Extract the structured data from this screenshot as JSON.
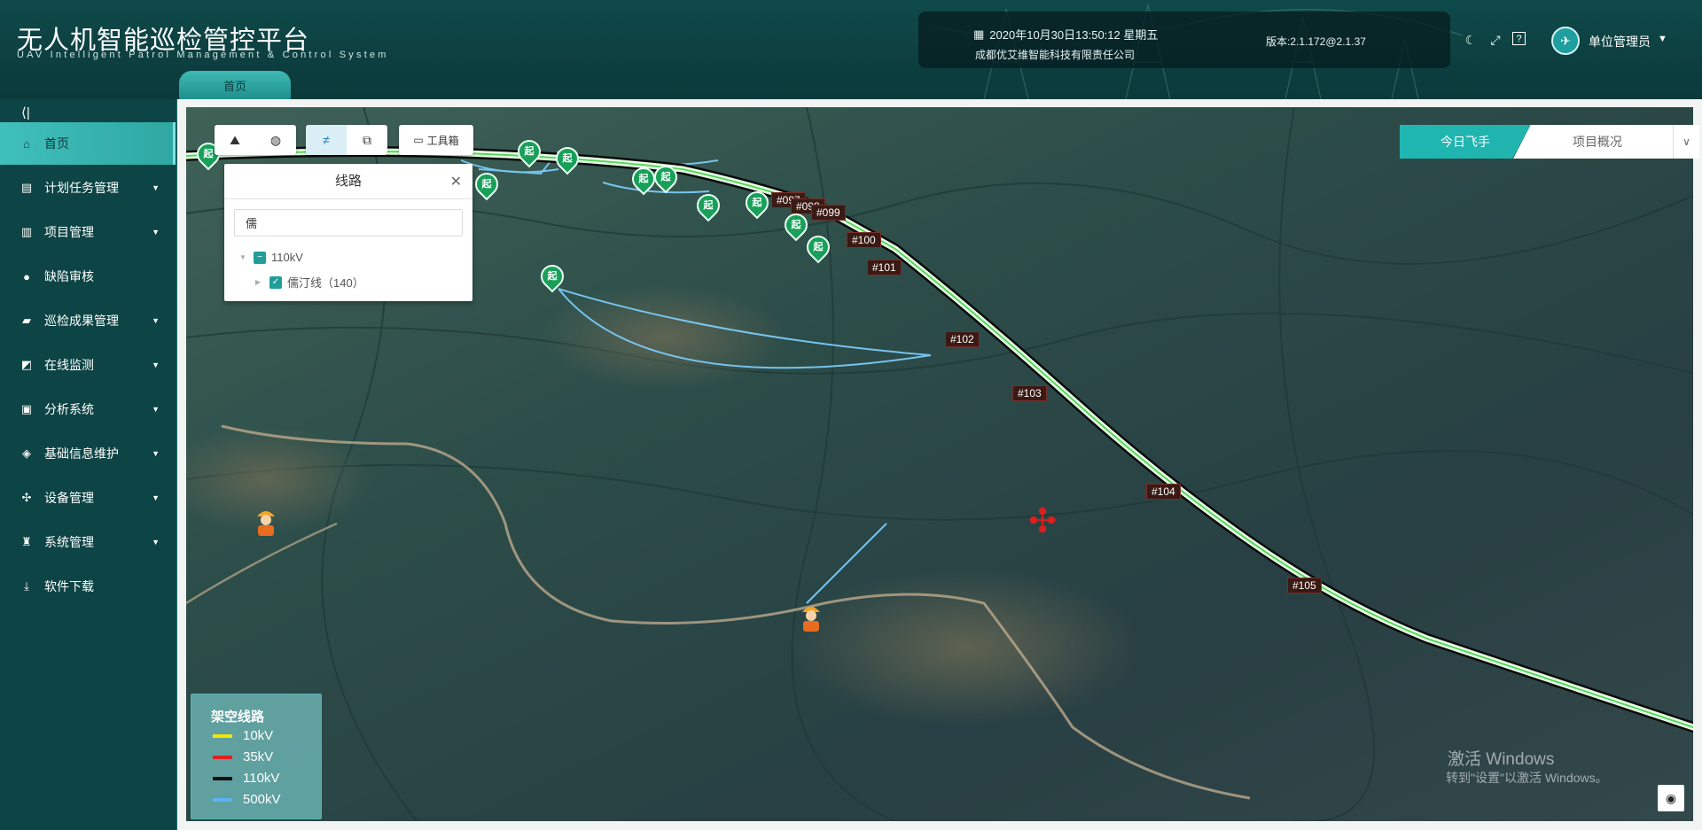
{
  "header": {
    "title": "无人机智能巡检管控平台",
    "subtitle": "UAV Intelligent Patrol Management & Control System",
    "datetime": "2020年10月30日13:50:12 星期五",
    "company": "成都优艾维智能科技有限责任公司",
    "version": "版本:2.1.172@2.1.37",
    "user": "单位管理员",
    "icons": [
      "theme-icon",
      "fullscreen-icon",
      "help-icon"
    ]
  },
  "tabs": [
    {
      "label": "首页"
    }
  ],
  "sidebar": {
    "items": [
      {
        "label": "首页",
        "icon": "home-icon",
        "active": true
      },
      {
        "label": "计划任务管理",
        "icon": "calendar-icon",
        "expandable": true
      },
      {
        "label": "项目管理",
        "icon": "project-icon",
        "expandable": true
      },
      {
        "label": "缺陷审核",
        "icon": "user-icon"
      },
      {
        "label": "巡检成果管理",
        "icon": "folder-icon",
        "expandable": true
      },
      {
        "label": "在线监测",
        "icon": "monitor-icon",
        "expandable": true
      },
      {
        "label": "分析系统",
        "icon": "analysis-icon",
        "expandable": true
      },
      {
        "label": "基础信息维护",
        "icon": "layers-icon",
        "expandable": true
      },
      {
        "label": "设备管理",
        "icon": "drone-icon",
        "expandable": true
      },
      {
        "label": "系统管理",
        "icon": "admin-icon",
        "expandable": true
      },
      {
        "label": "软件下载",
        "icon": "download-icon"
      }
    ]
  },
  "map": {
    "toolbar": {
      "toolbox_label": "工具箱"
    },
    "route_panel": {
      "title": "线路",
      "search_value": "儒",
      "tree": [
        {
          "label": "110kV",
          "children": [
            {
              "label": "儒汀线（140）"
            }
          ]
        }
      ]
    },
    "segment": {
      "active": "今日飞手",
      "other": "项目概况"
    },
    "towers": [
      "#097",
      "#098",
      "#099",
      "#100",
      "#101",
      "#102",
      "#103",
      "#104",
      "#105"
    ],
    "pin_label": "起",
    "legend": {
      "title": "架空线路",
      "items": [
        {
          "label": "10kV",
          "color": "#f2e600"
        },
        {
          "label": "35kV",
          "color": "#e02020"
        },
        {
          "label": "110kV",
          "color": "#111111"
        },
        {
          "label": "500kV",
          "color": "#5ab4f5"
        }
      ]
    },
    "watermark": {
      "line1": "激活 Windows",
      "line2": "转到\"设置\"以激活 Windows。"
    }
  }
}
